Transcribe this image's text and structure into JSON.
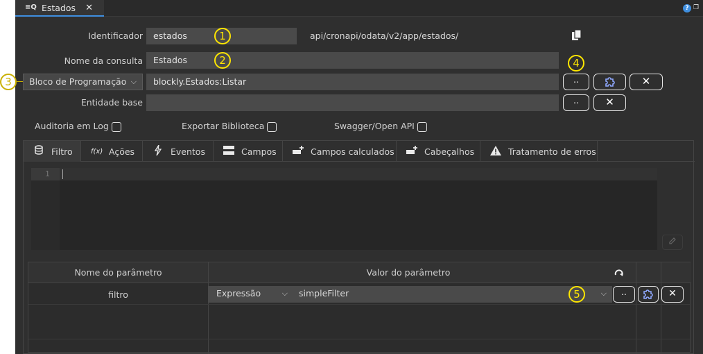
{
  "tab": {
    "title": "Estados"
  },
  "form": {
    "identificador_label": "Identificador",
    "identificador_value": "estados",
    "url": "api/cronapi/odata/v2/app/estados/",
    "nome_label": "Nome da consulta",
    "nome_value": "Estados",
    "source_type": "Bloco de Programação",
    "source_value": "blockly.Estados:Listar",
    "entidade_label": "Entidade base",
    "entidade_value": "",
    "dots_label": "..",
    "close_label": "✕",
    "checkboxes": [
      {
        "label": "Auditoria em Log",
        "checked": false
      },
      {
        "label": "Exportar Biblioteca",
        "checked": false
      },
      {
        "label": "Swagger/Open API",
        "checked": false
      }
    ]
  },
  "markers": [
    "1",
    "2",
    "3",
    "4",
    "5"
  ],
  "inner_tabs": [
    {
      "label": "Filtro",
      "icon": "database-icon"
    },
    {
      "label": "Ações",
      "icon": "function-icon"
    },
    {
      "label": "Eventos",
      "icon": "lightning-icon"
    },
    {
      "label": "Campos",
      "icon": "fields-icon"
    },
    {
      "label": "Campos calculados",
      "icon": "add-field-icon"
    },
    {
      "label": "Cabeçalhos",
      "icon": "add-header-icon"
    },
    {
      "label": "Tratamento de erros",
      "icon": "warning-icon"
    }
  ],
  "editor": {
    "line_number": "1"
  },
  "params": {
    "col_name": "Nome do parâmetro",
    "col_value": "Valor do parâmetro",
    "row_name": "filtro",
    "row_type": "Expressão",
    "row_value": "simpleFilter"
  }
}
